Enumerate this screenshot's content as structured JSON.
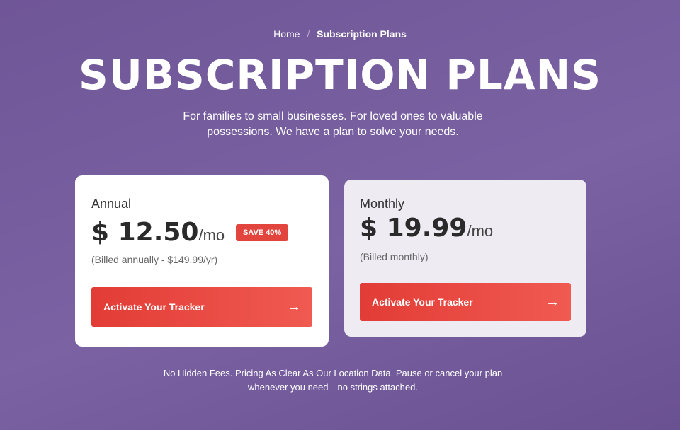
{
  "breadcrumb": {
    "home": "Home",
    "separator": "/",
    "current": "Subscription Plans"
  },
  "header": {
    "title": "SUBSCRIPTION PLANS",
    "subtitle": "For families to small businesses. For loved ones to valuable possessions. We have a plan to solve your needs."
  },
  "plans": [
    {
      "name": "Annual",
      "currency": "$",
      "amount": "12.50",
      "period": "/mo",
      "badge": "SAVE 40%",
      "billing": "(Billed annually - $149.99/yr)",
      "cta": "Activate Your Tracker"
    },
    {
      "name": "Monthly",
      "currency": "$",
      "amount": "19.99",
      "period": "/mo",
      "billing": "(Billed monthly)",
      "cta": "Activate Your Tracker"
    }
  ],
  "footnote": "No Hidden Fees. Pricing As Clear As Our Location Data. Pause or cancel your plan whenever you need—no strings attached.",
  "colors": {
    "background": "#735a9c",
    "accent": "#e2453d"
  },
  "icons": {
    "cta_arrow": "arrow-right-icon"
  }
}
